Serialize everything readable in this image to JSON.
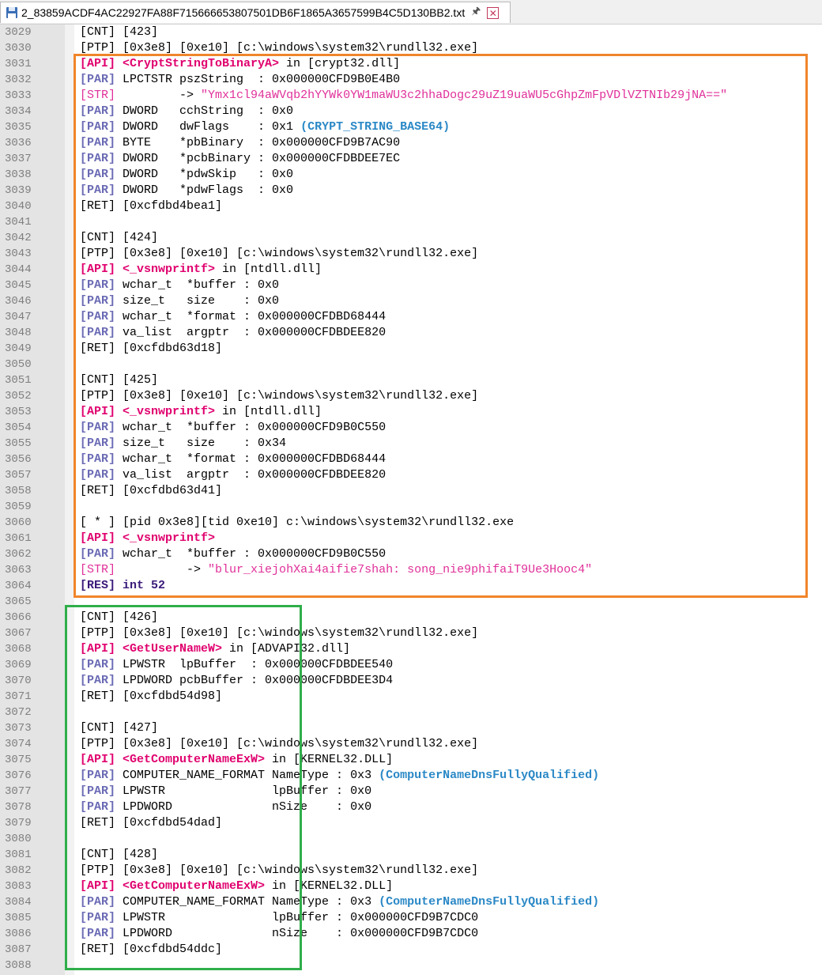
{
  "tab": {
    "title": "2_83859ACDF4AC22927FA88F715666653807501DB6F1865A3657599B4C5D130BB2.txt"
  },
  "colors": {
    "api": "#e0006e",
    "par": "#6b6bb5",
    "str": "#e0309a",
    "flag": "#2a88c6",
    "res": "#3a1a7a",
    "orange": "#f0852b",
    "green": "#2fae4a"
  },
  "lines": [
    {
      "n": "3029",
      "t": [
        {
          "c": "",
          "s": "[CNT] [423]"
        }
      ]
    },
    {
      "n": "3030",
      "t": [
        {
          "c": "",
          "s": "[PTP] [0x3e8] [0xe10] [c:\\windows\\system32\\rundll32.exe]"
        }
      ]
    },
    {
      "n": "3031",
      "t": [
        {
          "c": "api",
          "s": "[API] <CryptStringToBinaryA>"
        },
        {
          "c": "",
          "s": " in [crypt32.dll]"
        }
      ]
    },
    {
      "n": "3032",
      "t": [
        {
          "c": "par",
          "s": "[PAR]"
        },
        {
          "c": "",
          "s": " LPCTSTR pszString  : 0x000000CFD9B0E4B0"
        }
      ]
    },
    {
      "n": "3033",
      "t": [
        {
          "c": "str",
          "s": "[STR]"
        },
        {
          "c": "",
          "s": "         -> "
        },
        {
          "c": "str",
          "s": "\"Ymx1cl94aWVqb2hYYWk0YW1maWU3c2hhaDogc29uZ19uaWU5cGhpZmFpVDlVZTNIb29jNA==\""
        }
      ]
    },
    {
      "n": "3034",
      "t": [
        {
          "c": "par",
          "s": "[PAR]"
        },
        {
          "c": "",
          "s": " DWORD   cchString  : 0x0"
        }
      ]
    },
    {
      "n": "3035",
      "t": [
        {
          "c": "par",
          "s": "[PAR]"
        },
        {
          "c": "",
          "s": " DWORD   dwFlags    : 0x1 "
        },
        {
          "c": "flag",
          "s": "(CRYPT_STRING_BASE64)"
        }
      ]
    },
    {
      "n": "3036",
      "t": [
        {
          "c": "par",
          "s": "[PAR]"
        },
        {
          "c": "",
          "s": " BYTE    *pbBinary  : 0x000000CFD9B7AC90"
        }
      ]
    },
    {
      "n": "3037",
      "t": [
        {
          "c": "par",
          "s": "[PAR]"
        },
        {
          "c": "",
          "s": " DWORD   *pcbBinary : 0x000000CFDBDEE7EC"
        }
      ]
    },
    {
      "n": "3038",
      "t": [
        {
          "c": "par",
          "s": "[PAR]"
        },
        {
          "c": "",
          "s": " DWORD   *pdwSkip   : 0x0"
        }
      ]
    },
    {
      "n": "3039",
      "t": [
        {
          "c": "par",
          "s": "[PAR]"
        },
        {
          "c": "",
          "s": " DWORD   *pdwFlags  : 0x0"
        }
      ]
    },
    {
      "n": "3040",
      "t": [
        {
          "c": "",
          "s": "[RET] [0xcfdbd4bea1]"
        }
      ]
    },
    {
      "n": "3041",
      "t": []
    },
    {
      "n": "3042",
      "t": [
        {
          "c": "",
          "s": "[CNT] [424]"
        }
      ]
    },
    {
      "n": "3043",
      "t": [
        {
          "c": "",
          "s": "[PTP] [0x3e8] [0xe10] [c:\\windows\\system32\\rundll32.exe]"
        }
      ]
    },
    {
      "n": "3044",
      "t": [
        {
          "c": "api",
          "s": "[API] <_vsnwprintf>"
        },
        {
          "c": "",
          "s": " in [ntdll.dll]"
        }
      ]
    },
    {
      "n": "3045",
      "t": [
        {
          "c": "par",
          "s": "[PAR]"
        },
        {
          "c": "",
          "s": " wchar_t  *buffer : 0x0"
        }
      ]
    },
    {
      "n": "3046",
      "t": [
        {
          "c": "par",
          "s": "[PAR]"
        },
        {
          "c": "",
          "s": " size_t   size    : 0x0"
        }
      ]
    },
    {
      "n": "3047",
      "t": [
        {
          "c": "par",
          "s": "[PAR]"
        },
        {
          "c": "",
          "s": " wchar_t  *format : 0x000000CFDBD68444"
        }
      ]
    },
    {
      "n": "3048",
      "t": [
        {
          "c": "par",
          "s": "[PAR]"
        },
        {
          "c": "",
          "s": " va_list  argptr  : 0x000000CFDBDEE820"
        }
      ]
    },
    {
      "n": "3049",
      "t": [
        {
          "c": "",
          "s": "[RET] [0xcfdbd63d18]"
        }
      ]
    },
    {
      "n": "3050",
      "t": []
    },
    {
      "n": "3051",
      "t": [
        {
          "c": "",
          "s": "[CNT] [425]"
        }
      ]
    },
    {
      "n": "3052",
      "t": [
        {
          "c": "",
          "s": "[PTP] [0x3e8] [0xe10] [c:\\windows\\system32\\rundll32.exe]"
        }
      ]
    },
    {
      "n": "3053",
      "t": [
        {
          "c": "api",
          "s": "[API] <_vsnwprintf>"
        },
        {
          "c": "",
          "s": " in [ntdll.dll]"
        }
      ]
    },
    {
      "n": "3054",
      "t": [
        {
          "c": "par",
          "s": "[PAR]"
        },
        {
          "c": "",
          "s": " wchar_t  *buffer : 0x000000CFD9B0C550"
        }
      ]
    },
    {
      "n": "3055",
      "t": [
        {
          "c": "par",
          "s": "[PAR]"
        },
        {
          "c": "",
          "s": " size_t   size    : 0x34"
        }
      ]
    },
    {
      "n": "3056",
      "t": [
        {
          "c": "par",
          "s": "[PAR]"
        },
        {
          "c": "",
          "s": " wchar_t  *format : 0x000000CFDBD68444"
        }
      ]
    },
    {
      "n": "3057",
      "t": [
        {
          "c": "par",
          "s": "[PAR]"
        },
        {
          "c": "",
          "s": " va_list  argptr  : 0x000000CFDBDEE820"
        }
      ]
    },
    {
      "n": "3058",
      "t": [
        {
          "c": "",
          "s": "[RET] [0xcfdbd63d41]"
        }
      ]
    },
    {
      "n": "3059",
      "t": []
    },
    {
      "n": "3060",
      "t": [
        {
          "c": "",
          "s": "[ * ] [pid 0x3e8][tid 0xe10] c:\\windows\\system32\\rundll32.exe"
        }
      ]
    },
    {
      "n": "3061",
      "t": [
        {
          "c": "api",
          "s": "[API] <_vsnwprintf>"
        }
      ]
    },
    {
      "n": "3062",
      "t": [
        {
          "c": "par",
          "s": "[PAR]"
        },
        {
          "c": "",
          "s": " wchar_t  *buffer : 0x000000CFD9B0C550"
        }
      ]
    },
    {
      "n": "3063",
      "t": [
        {
          "c": "str",
          "s": "[STR]"
        },
        {
          "c": "",
          "s": "          -> "
        },
        {
          "c": "str",
          "s": "\"blur_xiejohXai4aifie7shah: song_nie9phifaiT9Ue3Hooc4\""
        }
      ]
    },
    {
      "n": "3064",
      "t": [
        {
          "c": "res",
          "s": "[RES] int 52"
        }
      ]
    },
    {
      "n": "3065",
      "t": []
    },
    {
      "n": "3066",
      "t": [
        {
          "c": "",
          "s": "[CNT] [426]"
        }
      ]
    },
    {
      "n": "3067",
      "t": [
        {
          "c": "",
          "s": "[PTP] [0x3e8] [0xe10] [c:\\windows\\system32\\rundll32.exe]"
        }
      ]
    },
    {
      "n": "3068",
      "t": [
        {
          "c": "api",
          "s": "[API] <GetUserNameW>"
        },
        {
          "c": "",
          "s": " in [ADVAPI32.dll]"
        }
      ]
    },
    {
      "n": "3069",
      "t": [
        {
          "c": "par",
          "s": "[PAR]"
        },
        {
          "c": "",
          "s": " LPWSTR  lpBuffer  : 0x000000CFDBDEE540"
        }
      ]
    },
    {
      "n": "3070",
      "t": [
        {
          "c": "par",
          "s": "[PAR]"
        },
        {
          "c": "",
          "s": " LPDWORD pcbBuffer : 0x000000CFDBDEE3D4"
        }
      ]
    },
    {
      "n": "3071",
      "t": [
        {
          "c": "",
          "s": "[RET] [0xcfdbd54d98]"
        }
      ]
    },
    {
      "n": "3072",
      "t": []
    },
    {
      "n": "3073",
      "t": [
        {
          "c": "",
          "s": "[CNT] [427]"
        }
      ]
    },
    {
      "n": "3074",
      "t": [
        {
          "c": "",
          "s": "[PTP] [0x3e8] [0xe10] [c:\\windows\\system32\\rundll32.exe]"
        }
      ]
    },
    {
      "n": "3075",
      "t": [
        {
          "c": "api",
          "s": "[API] <GetComputerNameExW>"
        },
        {
          "c": "",
          "s": " in [KERNEL32.DLL]"
        }
      ]
    },
    {
      "n": "3076",
      "t": [
        {
          "c": "par",
          "s": "[PAR]"
        },
        {
          "c": "",
          "s": " COMPUTER_NAME_FORMAT NameType : 0x3 "
        },
        {
          "c": "flag",
          "s": "(ComputerNameDnsFullyQualified)"
        }
      ]
    },
    {
      "n": "3077",
      "t": [
        {
          "c": "par",
          "s": "[PAR]"
        },
        {
          "c": "",
          "s": " LPWSTR               lpBuffer : 0x0"
        }
      ]
    },
    {
      "n": "3078",
      "t": [
        {
          "c": "par",
          "s": "[PAR]"
        },
        {
          "c": "",
          "s": " LPDWORD              nSize    : 0x0"
        }
      ]
    },
    {
      "n": "3079",
      "t": [
        {
          "c": "",
          "s": "[RET] [0xcfdbd54dad]"
        }
      ]
    },
    {
      "n": "3080",
      "t": []
    },
    {
      "n": "3081",
      "t": [
        {
          "c": "",
          "s": "[CNT] [428]"
        }
      ]
    },
    {
      "n": "3082",
      "t": [
        {
          "c": "",
          "s": "[PTP] [0x3e8] [0xe10] [c:\\windows\\system32\\rundll32.exe]"
        }
      ]
    },
    {
      "n": "3083",
      "t": [
        {
          "c": "api",
          "s": "[API] <GetComputerNameExW>"
        },
        {
          "c": "",
          "s": " in [KERNEL32.DLL]"
        }
      ]
    },
    {
      "n": "3084",
      "t": [
        {
          "c": "par",
          "s": "[PAR]"
        },
        {
          "c": "",
          "s": " COMPUTER_NAME_FORMAT NameType : 0x3 "
        },
        {
          "c": "flag",
          "s": "(ComputerNameDnsFullyQualified)"
        }
      ]
    },
    {
      "n": "3085",
      "t": [
        {
          "c": "par",
          "s": "[PAR]"
        },
        {
          "c": "",
          "s": " LPWSTR               lpBuffer : 0x000000CFD9B7CDC0"
        }
      ]
    },
    {
      "n": "3086",
      "t": [
        {
          "c": "par",
          "s": "[PAR]"
        },
        {
          "c": "",
          "s": " LPDWORD              nSize    : 0x000000CFD9B7CDC0"
        }
      ]
    },
    {
      "n": "3087",
      "t": [
        {
          "c": "",
          "s": "[RET] [0xcfdbd54ddc]"
        }
      ]
    },
    {
      "n": "3088",
      "t": []
    }
  ]
}
